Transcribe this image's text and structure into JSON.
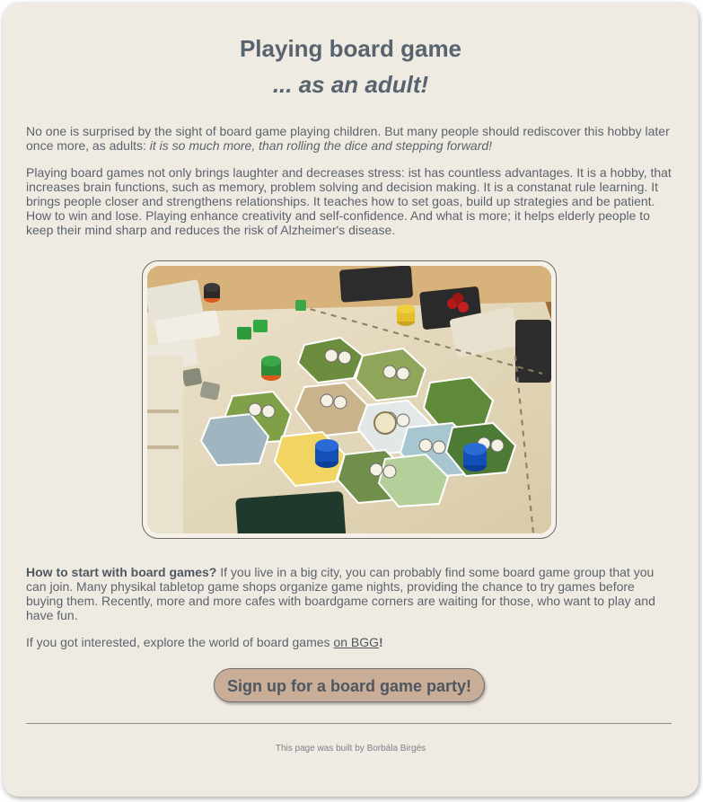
{
  "header": {
    "title": "Playing board game",
    "subtitle": "... as an adult!"
  },
  "intro": {
    "text": "No one is surprised by the sight of board game playing children. But many people should rediscover this hobby later once more, as adults: ",
    "emphasis": "it is so much more, than rolling the dice and stepping forward!"
  },
  "benefits": {
    "text": "Playing board games not only brings laughter and decreases stress: ist has countless advantages. It is a hobby, that increases brain functions, such as memory, problem solving and decision making. It is a constanat rule learning. It brings people closer and strengthens relationships. It teaches how to set goas, build up strategies and be patient. How to win and lose. Playing enhance creativity and self-confidence. And what is more; it helps elderly people to keep their mind sharp and reduces the risk of Alzheimer's disease."
  },
  "image": {
    "alt": "Board game on a table"
  },
  "how_to": {
    "heading": "How to start with board games?",
    "text": " If you live in a big city, you can probably find some board game group that you can join. Many physikal tabletop game shops organize game nights, providing the chance to try games before buying them. Recently, more and more cafes with boardgame corners are waiting for those, who want to play and have fun."
  },
  "explore": {
    "text": "If you got interested, explore the world of board games ",
    "link_label": "on BGG",
    "suffix": "!"
  },
  "cta": {
    "label": "Sign up for a board game party!"
  },
  "footer": {
    "text": "This page was built by Borbála Birgés"
  },
  "colors": {
    "background": "#f0ebe2",
    "heading": "#57636f",
    "text": "#5b636c",
    "button": "#c9ad96"
  }
}
